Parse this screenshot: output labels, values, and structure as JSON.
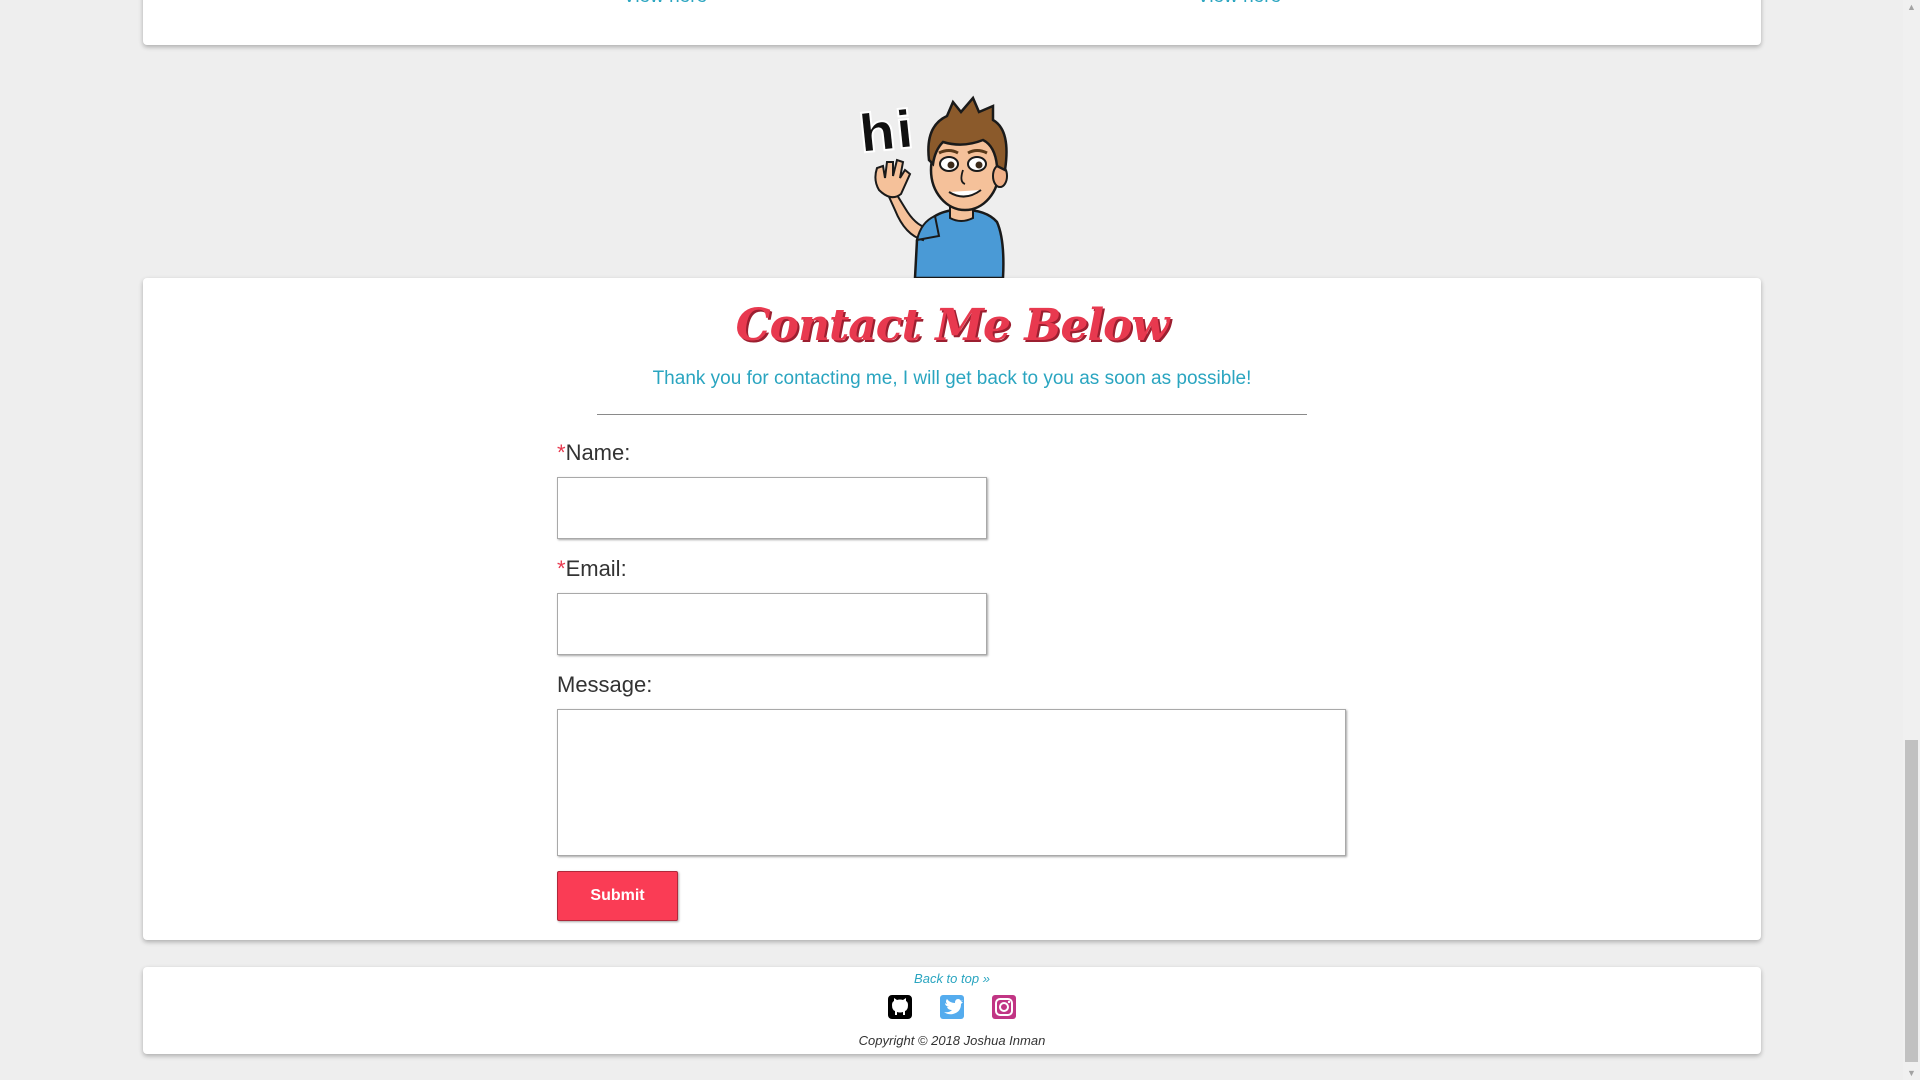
{
  "projects": {
    "left_link": "View here",
    "right_link": "View here"
  },
  "contact": {
    "title": "Contact Me Below",
    "subtitle": "Thank you for contacting me, I will get back to you as soon as possible!",
    "required_mark": "*",
    "name_label": "Name:",
    "email_label": "Email:",
    "message_label": "Message:",
    "name_value": "",
    "email_value": "",
    "message_value": "",
    "submit_label": "Submit"
  },
  "avatar": {
    "greeting": "hi"
  },
  "footer": {
    "back_to_top": "Back to top »",
    "social": [
      {
        "name": "github-icon",
        "color": "#000000"
      },
      {
        "name": "twitter-icon",
        "color": "#55acee"
      },
      {
        "name": "instagram-icon",
        "color": "#c13584"
      }
    ],
    "copyright": "Copyright © 2018 Joshua Inman"
  },
  "colors": {
    "accent_red": "#e8394f",
    "button_red": "#fa3c55",
    "link_blue": "#2aa5c0",
    "background": "#eeeeee"
  }
}
